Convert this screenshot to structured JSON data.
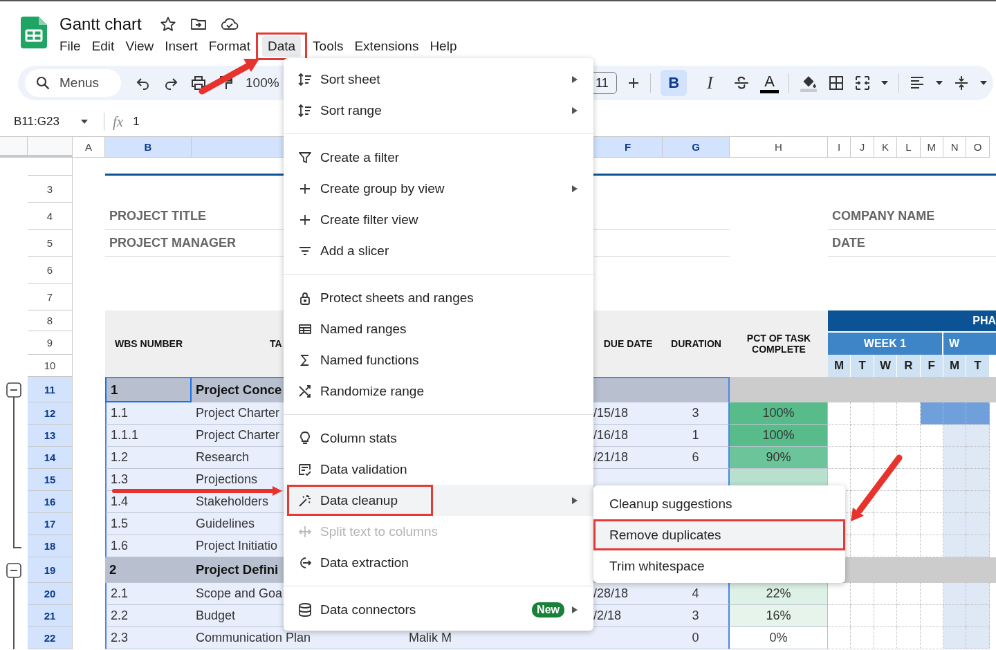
{
  "window": {
    "title": "Gantt chart"
  },
  "menu_bar": [
    {
      "label": "File",
      "selected": false,
      "highlighted": false
    },
    {
      "label": "Edit",
      "selected": false,
      "highlighted": false
    },
    {
      "label": "View",
      "selected": false,
      "highlighted": false
    },
    {
      "label": "Insert",
      "selected": false,
      "highlighted": false
    },
    {
      "label": "Format",
      "selected": false,
      "highlighted": false
    },
    {
      "label": "Data",
      "selected": true,
      "highlighted": true
    },
    {
      "label": "Tools",
      "selected": false,
      "highlighted": false
    },
    {
      "label": "Extensions",
      "selected": false,
      "highlighted": false
    },
    {
      "label": "Help",
      "selected": false,
      "highlighted": false
    }
  ],
  "toolbar": {
    "search_placeholder": "Menus",
    "zoom": "100%",
    "font_size": "11",
    "format_buttons": [
      {
        "glyph": "B",
        "selected": true
      },
      {
        "glyph": "I",
        "selected": false
      }
    ],
    "text_color_glyph": "A"
  },
  "formula_bar": {
    "cell_range": "B11:G23",
    "fx": "fx",
    "value": "1"
  },
  "sheet": {
    "columns": [
      {
        "label": "A",
        "selected": false
      },
      {
        "label": "B",
        "selected": true
      },
      {
        "selected": true
      },
      {
        "label": "F",
        "selected": true
      },
      {
        "label": "G",
        "selected": true
      },
      {
        "label": "H",
        "selected": false
      },
      {
        "label": "I",
        "selected": false
      },
      {
        "label": "J",
        "selected": false
      },
      {
        "label": "K",
        "selected": false
      },
      {
        "label": "L",
        "selected": false
      },
      {
        "label": "M",
        "selected": false
      },
      {
        "label": "N",
        "selected": false
      },
      {
        "label": "O",
        "selected": false
      }
    ],
    "table_header": {
      "labels": [
        "WBS NUMBER",
        "TA",
        "DUE DATE",
        "DURATION",
        "PCT OF TASK COMPLETE"
      ],
      "phase": "PHA",
      "weeks": [
        "WEEK 1",
        "W"
      ],
      "days": [
        "M",
        "T",
        "W",
        "R",
        "F",
        "M",
        "T"
      ]
    },
    "highlight_days": [
      false,
      false,
      false,
      false,
      false,
      true,
      true
    ],
    "rows": [
      {
        "num": "3",
        "selected": false,
        "kind": "blank"
      },
      {
        "num": "4",
        "selected": false,
        "kind": "info",
        "left": "PROJECT TITLE",
        "right": "COMPANY NAME"
      },
      {
        "num": "5",
        "selected": false,
        "kind": "info",
        "left": "PROJECT MANAGER",
        "right": "DATE"
      },
      {
        "num": "6",
        "selected": false,
        "kind": "blank"
      },
      {
        "num": "7",
        "selected": false,
        "kind": "blank"
      },
      {
        "num": "8",
        "selected": false,
        "kind": "head_top"
      },
      {
        "num": "9",
        "selected": false,
        "kind": "head_mid"
      },
      {
        "num": "10",
        "selected": false,
        "kind": "head_bottom"
      },
      {
        "num": "11",
        "selected": true,
        "kind": "phase",
        "expanded": true,
        "wbs": "1",
        "task": "Project Conce"
      },
      {
        "num": "12",
        "selected": true,
        "kind": "task",
        "wbs": "1.1",
        "task": "Project Charter",
        "due": "/15/18",
        "duration": "3",
        "pct": "100%",
        "color": "#57bb8a",
        "bar": [
          false,
          false,
          false,
          false,
          true,
          true,
          true
        ]
      },
      {
        "num": "13",
        "selected": true,
        "kind": "task",
        "wbs": "1.1.1",
        "task": "Project Charter",
        "due": "/16/18",
        "duration": "1",
        "pct": "100%",
        "color": "#57bb8a"
      },
      {
        "num": "14",
        "selected": true,
        "kind": "task",
        "wbs": "1.2",
        "task": "Research",
        "due": "/21/18",
        "duration": "6",
        "pct": "90%",
        "color": "#6cc59a"
      },
      {
        "num": "15",
        "selected": true,
        "kind": "task",
        "wbs": "1.3",
        "task": "Projections",
        "color": "#b7e1cd"
      },
      {
        "num": "16",
        "selected": true,
        "kind": "task",
        "wbs": "1.4",
        "task": "Stakeholders"
      },
      {
        "num": "17",
        "selected": true,
        "kind": "task",
        "wbs": "1.5",
        "task": "Guidelines"
      },
      {
        "num": "18",
        "selected": true,
        "kind": "task",
        "wbs": "1.6",
        "task": "Project Initiatio"
      },
      {
        "num": "19",
        "selected": true,
        "kind": "phase",
        "expanded": true,
        "wbs": "2",
        "task": "Project Defini"
      },
      {
        "num": "20",
        "selected": true,
        "kind": "task",
        "wbs": "2.1",
        "task": "Scope and Goa",
        "due": "/28/18",
        "duration": "4",
        "pct": "22%",
        "color": "#def1e7"
      },
      {
        "num": "21",
        "selected": true,
        "kind": "task",
        "wbs": "2.2",
        "task": "Budget",
        "due": "/2/18",
        "duration": "3",
        "pct": "16%",
        "color": "#e6f4ec"
      },
      {
        "num": "22",
        "selected": true,
        "kind": "task",
        "wbs": "2.3",
        "task": "Communication Plan",
        "assignee": "Malik M",
        "duration": "0",
        "pct": "0%",
        "color": "#ffffff"
      }
    ]
  },
  "data_menu": {
    "sections": [
      [
        {
          "label": "Sort sheet",
          "submenu": true,
          "selected": false,
          "disabled": false,
          "highlighted": false
        },
        {
          "label": "Sort range",
          "submenu": true,
          "selected": false,
          "disabled": false,
          "highlighted": false
        }
      ],
      [
        {
          "label": "Create a filter",
          "submenu": false,
          "selected": false,
          "disabled": false,
          "highlighted": false
        },
        {
          "label": "Create group by view",
          "submenu": true,
          "selected": false,
          "disabled": false,
          "highlighted": false
        },
        {
          "label": "Create filter view",
          "submenu": false,
          "selected": false,
          "disabled": false,
          "highlighted": false
        },
        {
          "label": "Add a slicer",
          "submenu": false,
          "selected": false,
          "disabled": false,
          "highlighted": false
        }
      ],
      [
        {
          "label": "Protect sheets and ranges",
          "submenu": false,
          "selected": false,
          "disabled": false,
          "highlighted": false
        },
        {
          "label": "Named ranges",
          "submenu": false,
          "selected": false,
          "disabled": false,
          "highlighted": false
        },
        {
          "label": "Named functions",
          "submenu": false,
          "selected": false,
          "disabled": false,
          "highlighted": false
        },
        {
          "label": "Randomize range",
          "submenu": false,
          "selected": false,
          "disabled": false,
          "highlighted": false
        }
      ],
      [
        {
          "label": "Column stats",
          "submenu": false,
          "selected": false,
          "disabled": false,
          "highlighted": false
        },
        {
          "label": "Data validation",
          "submenu": false,
          "selected": false,
          "disabled": false,
          "highlighted": false
        },
        {
          "label": "Data cleanup",
          "submenu": true,
          "selected": true,
          "disabled": false,
          "highlighted": true
        },
        {
          "label": "Split text to columns",
          "submenu": false,
          "selected": false,
          "disabled": true,
          "highlighted": false
        },
        {
          "label": "Data extraction",
          "submenu": false,
          "selected": false,
          "disabled": false,
          "highlighted": false
        }
      ],
      [
        {
          "label": "Data connectors",
          "badge": "New",
          "submenu": true,
          "selected": false,
          "disabled": false,
          "highlighted": false
        }
      ]
    ]
  },
  "cleanup_submenu": {
    "items": [
      {
        "label": "Cleanup suggestions",
        "selected": false,
        "highlighted": false
      },
      {
        "label": "Remove duplicates",
        "selected": true,
        "highlighted": true
      },
      {
        "label": "Trim whitespace",
        "selected": false,
        "highlighted": false
      }
    ]
  }
}
